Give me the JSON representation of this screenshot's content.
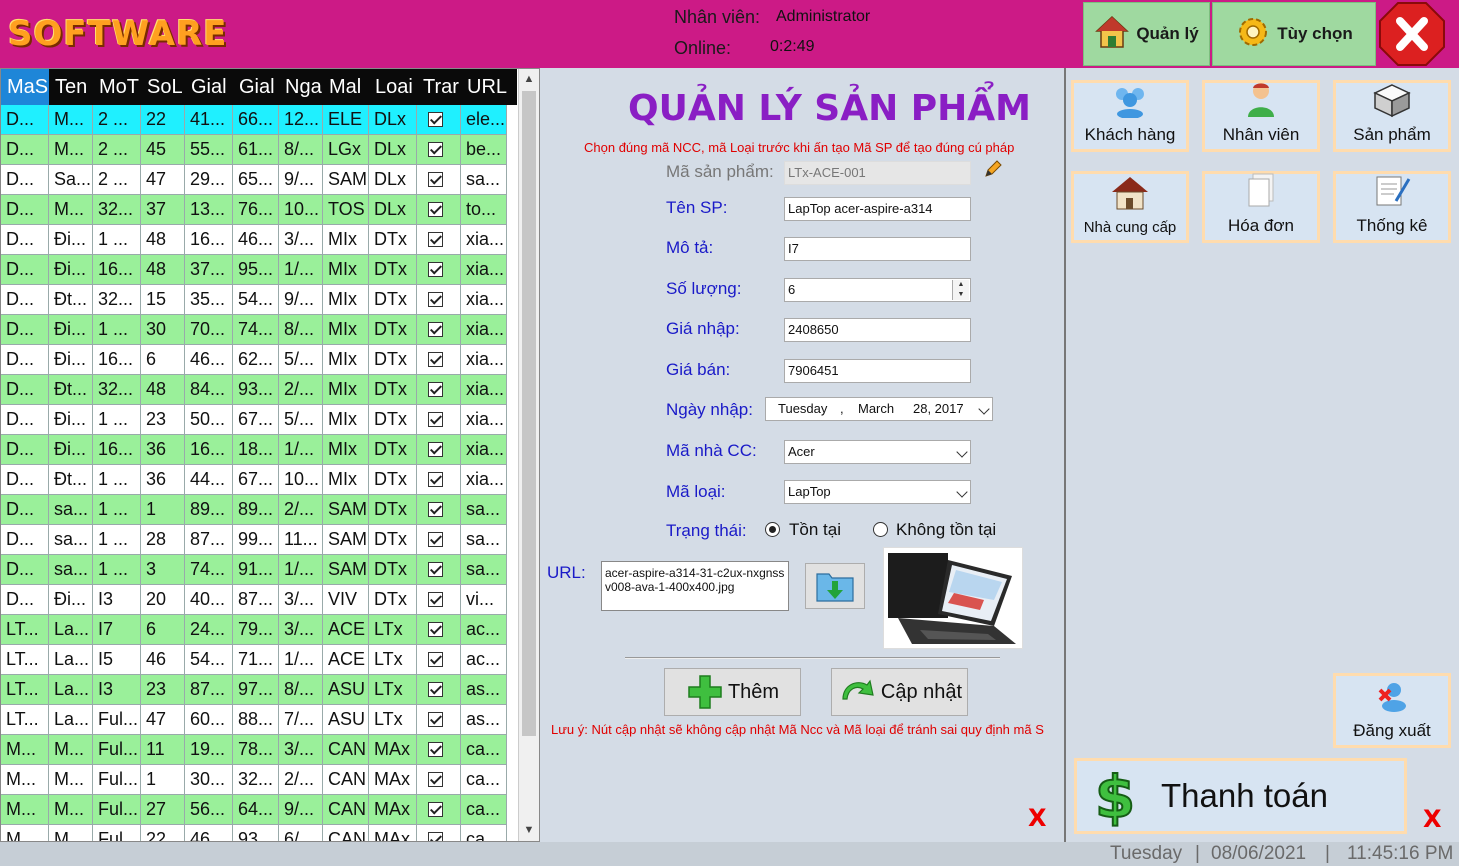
{
  "header": {
    "logo": "SOFTWARE",
    "employee_label": "Nhân viên:",
    "employee_value": "Administrator",
    "online_label": "Online:",
    "online_value": "0:2:49",
    "btn_manage": "Quản lý",
    "btn_options": "Tùy chọn"
  },
  "grid": {
    "columns": [
      "MaS",
      "Ten",
      "MoT",
      "SoL",
      "Gial",
      "Gial",
      "Nga",
      "Mal",
      "Loai",
      "Trar",
      "URL"
    ],
    "rows": [
      [
        "D...",
        "M...",
        "2 ...",
        "22",
        "41...",
        "66...",
        "12...",
        "ELE",
        "DLx",
        "ele..."
      ],
      [
        "D...",
        "M...",
        "2 ...",
        "45",
        "55...",
        "61...",
        "8/...",
        "LGx",
        "DLx",
        "be..."
      ],
      [
        "D...",
        "Sa...",
        "2 ...",
        "47",
        "29...",
        "65...",
        "9/...",
        "SAM",
        "DLx",
        "sa..."
      ],
      [
        "D...",
        "M...",
        "32...",
        "37",
        "13...",
        "76...",
        "10...",
        "TOS",
        "DLx",
        "to..."
      ],
      [
        "D...",
        "Đi...",
        "1 ...",
        "48",
        "16...",
        "46...",
        "3/...",
        "MIx",
        "DTx",
        "xia..."
      ],
      [
        "D...",
        "Đi...",
        "16...",
        "48",
        "37...",
        "95...",
        "1/...",
        "MIx",
        "DTx",
        "xia..."
      ],
      [
        "D...",
        "Đt...",
        "32...",
        "15",
        "35...",
        "54...",
        "9/...",
        "MIx",
        "DTx",
        "xia..."
      ],
      [
        "D...",
        "Đi...",
        "1 ...",
        "30",
        "70...",
        "74...",
        "8/...",
        "MIx",
        "DTx",
        "xia..."
      ],
      [
        "D...",
        "Đi...",
        "16...",
        "6",
        "46...",
        "62...",
        "5/...",
        "MIx",
        "DTx",
        "xia..."
      ],
      [
        "D...",
        "Đt...",
        "32...",
        "48",
        "84...",
        "93...",
        "2/...",
        "MIx",
        "DTx",
        "xia..."
      ],
      [
        "D...",
        "Đi...",
        "1 ...",
        "23",
        "50...",
        "67...",
        "5/...",
        "MIx",
        "DTx",
        "xia..."
      ],
      [
        "D...",
        "Đi...",
        "16...",
        "36",
        "16...",
        "18...",
        "1/...",
        "MIx",
        "DTx",
        "xia..."
      ],
      [
        "D...",
        "Đt...",
        "1 ...",
        "36",
        "44...",
        "67...",
        "10...",
        "MIx",
        "DTx",
        "xia..."
      ],
      [
        "D...",
        "sa...",
        "1 ...",
        "1",
        "89...",
        "89...",
        "2/...",
        "SAM",
        "DTx",
        "sa..."
      ],
      [
        "D...",
        "sa...",
        "1 ...",
        "28",
        "87...",
        "99...",
        "11...",
        "SAM",
        "DTx",
        "sa..."
      ],
      [
        "D...",
        "sa...",
        "1 ...",
        "3",
        "74...",
        "91...",
        "1/...",
        "SAM",
        "DTx",
        "sa..."
      ],
      [
        "D...",
        "Đi...",
        "I3",
        "20",
        "40...",
        "87...",
        "3/...",
        "VIV",
        "DTx",
        "vi..."
      ],
      [
        "LT...",
        "La...",
        "I7",
        "6",
        "24...",
        "79...",
        "3/...",
        "ACE",
        "LTx",
        "ac..."
      ],
      [
        "LT...",
        "La...",
        "I5",
        "46",
        "54...",
        "71...",
        "1/...",
        "ACE",
        "LTx",
        "ac..."
      ],
      [
        "LT...",
        "La...",
        "I3",
        "23",
        "87...",
        "97...",
        "8/...",
        "ASU",
        "LTx",
        "as..."
      ],
      [
        "LT...",
        "La...",
        "Ful...",
        "47",
        "60...",
        "88...",
        "7/...",
        "ASU",
        "LTx",
        "as..."
      ],
      [
        "M...",
        "M...",
        "Ful...",
        "11",
        "19...",
        "78...",
        "3/...",
        "CAN",
        "MAx",
        "ca..."
      ],
      [
        "M...",
        "M...",
        "Ful...",
        "1",
        "30...",
        "32...",
        "2/...",
        "CAN",
        "MAx",
        "ca..."
      ],
      [
        "M...",
        "M...",
        "Ful...",
        "27",
        "56...",
        "64...",
        "9/...",
        "CAN",
        "MAx",
        "ca..."
      ],
      [
        "M...",
        "M...",
        "Ful...",
        "22",
        "46...",
        "93...",
        "6/...",
        "CAN",
        "MAx",
        "ca..."
      ]
    ]
  },
  "form": {
    "title": "QUẢN LÝ SẢN PHẨM",
    "hint": "Chọn đúng mã NCC, mã Loại trước khi ấn tạo Mã SP để tạo đúng cú pháp",
    "product_code_label": "Mã sản phẩm:",
    "product_code_value": "LTx-ACE-001",
    "name_label": "Tên SP:",
    "name_value": "LapTop acer-aspire-a314",
    "desc_label": "Mô tả:",
    "desc_value": "I7",
    "qty_label": "Số lượng:",
    "qty_value": "6",
    "import_price_label": "Giá nhập:",
    "import_price_value": "2408650",
    "sale_price_label": "Giá bán:",
    "sale_price_value": "7906451",
    "import_date_label": "Ngày nhập:",
    "import_date_day": "Tuesday",
    "import_date_sep": ",",
    "import_date_month": "March",
    "import_date_rest": "28, 2017",
    "supplier_label": "Mã nhà CC:",
    "supplier_value": "Acer",
    "type_label": "Mã loại:",
    "type_value": "LapTop",
    "status_label": "Trạng thái:",
    "status_in_stock": "Tồn tại",
    "status_not_in_stock": "Không tồn tại",
    "url_label": "URL:",
    "url_value": "acer-aspire-a314-31-c2ux-nxgnssv008-ava-1-400x400.jpg",
    "add_button": "Thêm",
    "update_button": "Cập nhật",
    "note": "Lưu ý: Nút cập nhật sẽ không cập nhật Mã Ncc và Mã loại để tránh sai quy định mã S"
  },
  "nav": {
    "customers": "Khách hàng",
    "employees": "Nhân viên",
    "products": "Sản phẩm",
    "suppliers": "Nhà cung cấp",
    "invoices": "Hóa đơn",
    "stats": "Thống kê",
    "logout": "Đăng xuất",
    "checkout": "Thanh toán"
  },
  "marks": {
    "close_x": "X"
  },
  "status_bar": {
    "day": "Tuesday",
    "sep1": "|",
    "date": "08/06/2021",
    "sep2": "|",
    "time": "11:45:16 PM"
  }
}
